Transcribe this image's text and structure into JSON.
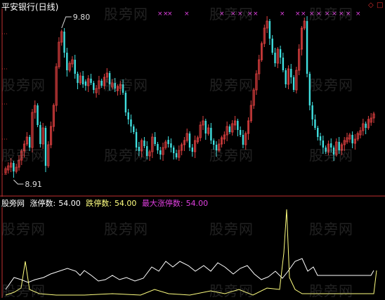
{
  "colors": {
    "background": "#000000",
    "up": "#e04040",
    "down": "#40e0e0",
    "marker": "#e040e0",
    "ind_white": "#ffffff",
    "ind_yellow": "#ffff80",
    "ind_magenta": "#e040e0",
    "divider": "#c03030"
  },
  "header": {
    "title": "平安银行(日线)",
    "icons": [
      "diamond-icon",
      "square-icon"
    ]
  },
  "price_chart": {
    "high_label": "9.80",
    "low_label": "8.91"
  },
  "indicator": {
    "name": "股旁网",
    "items": [
      {
        "label": "涨停数:",
        "value": "54.00",
        "color": "#ffffff"
      },
      {
        "label": "跌停数:",
        "value": "54.00",
        "color": "#ffff80"
      },
      {
        "label": "最大涨停数:",
        "value": "54.00",
        "color": "#e040e0"
      }
    ]
  },
  "watermark": "股旁网"
}
